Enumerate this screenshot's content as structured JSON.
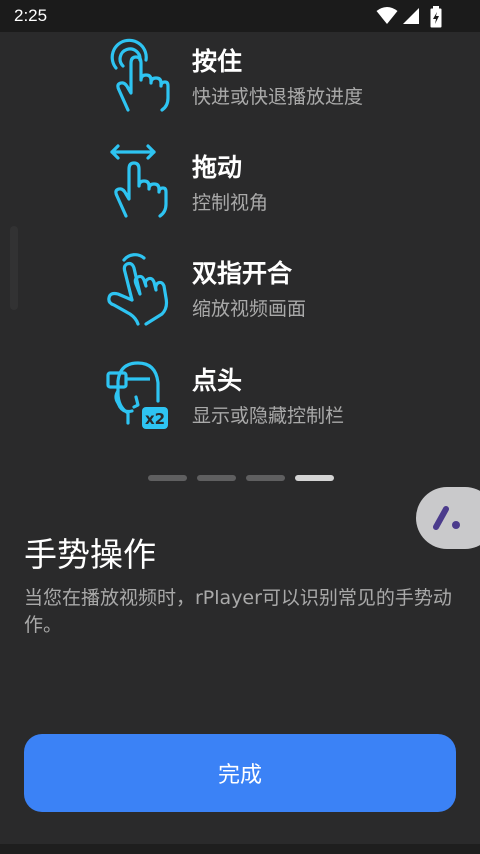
{
  "status_bar": {
    "time": "2:25",
    "icons": [
      "wifi-icon",
      "cell-signal-icon",
      "battery-charging-icon"
    ]
  },
  "gestures": [
    {
      "icon": "tap-hold-gesture-icon",
      "title": "按住",
      "description": "快进或快退播放进度"
    },
    {
      "icon": "drag-gesture-icon",
      "title": "拖动",
      "description": "控制视角"
    },
    {
      "icon": "pinch-gesture-icon",
      "title": "双指开合",
      "description": "缩放视频画面"
    },
    {
      "icon": "nod-head-x2-icon",
      "title": "点头",
      "description": "显示或隐藏控制栏",
      "badge": "x2"
    }
  ],
  "pager": {
    "count": 4,
    "active_index": 3
  },
  "section": {
    "title": "手势操作",
    "description": "当您在播放视频时，rPlayer可以识别常见的手势动作。"
  },
  "done_button": {
    "label": "完成"
  },
  "colors": {
    "accent_cyan": "#2ec4f2",
    "button_blue": "#3b82f6",
    "background": "#2a2a2b"
  }
}
